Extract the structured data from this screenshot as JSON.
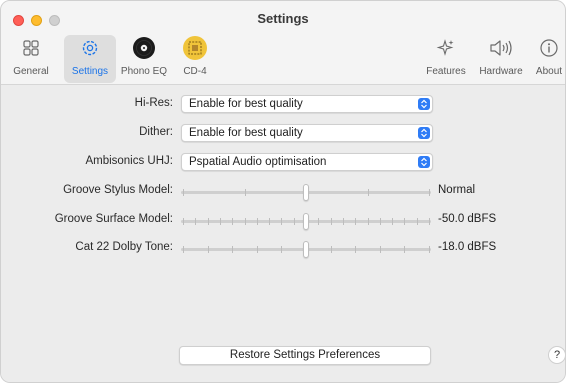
{
  "window": {
    "title": "Settings"
  },
  "toolbar": {
    "tabs": [
      {
        "id": "general",
        "label": "General",
        "icon": "grid-icon",
        "active": false
      },
      {
        "id": "settings",
        "label": "Settings",
        "icon": "gear-icon",
        "active": true
      },
      {
        "id": "phono-eq",
        "label": "Phono EQ",
        "icon": "vinyl-record-icon",
        "active": false
      },
      {
        "id": "cd4",
        "label": "CD-4",
        "icon": "cd4-quad-icon",
        "active": false
      },
      {
        "id": "features",
        "label": "Features",
        "icon": "sparkles-icon",
        "active": false
      },
      {
        "id": "hardware",
        "label": "Hardware",
        "icon": "speaker-wave-icon",
        "active": false
      },
      {
        "id": "about",
        "label": "About",
        "icon": "info-circle-icon",
        "active": false
      }
    ]
  },
  "popups": [
    {
      "label": "Hi-Res:",
      "value": "Enable for best quality"
    },
    {
      "label": "Dither:",
      "value": "Enable for best quality"
    },
    {
      "label": "Ambisonics UHJ:",
      "value": "Pspatial Audio optimisation"
    }
  ],
  "sliders": [
    {
      "label": "Groove Stylus Model:",
      "value_text": "Normal",
      "position": 0.5,
      "ticks": 5
    },
    {
      "label": "Groove Surface Model:",
      "value_text": "-50.0 dBFS",
      "position": 0.5,
      "ticks": 21
    },
    {
      "label": "Cat 22 Dolby Tone:",
      "value_text": "-18.0 dBFS",
      "position": 0.5,
      "ticks": 11
    }
  ],
  "buttons": {
    "restore": "Restore Settings Preferences",
    "help": "?"
  },
  "colors": {
    "accent": "#1a73e8",
    "popup_chevron": "#2f7cf6",
    "close": "#ff5f57",
    "minimize": "#febc2e",
    "zoom_inactive": "#d0d0d0"
  }
}
